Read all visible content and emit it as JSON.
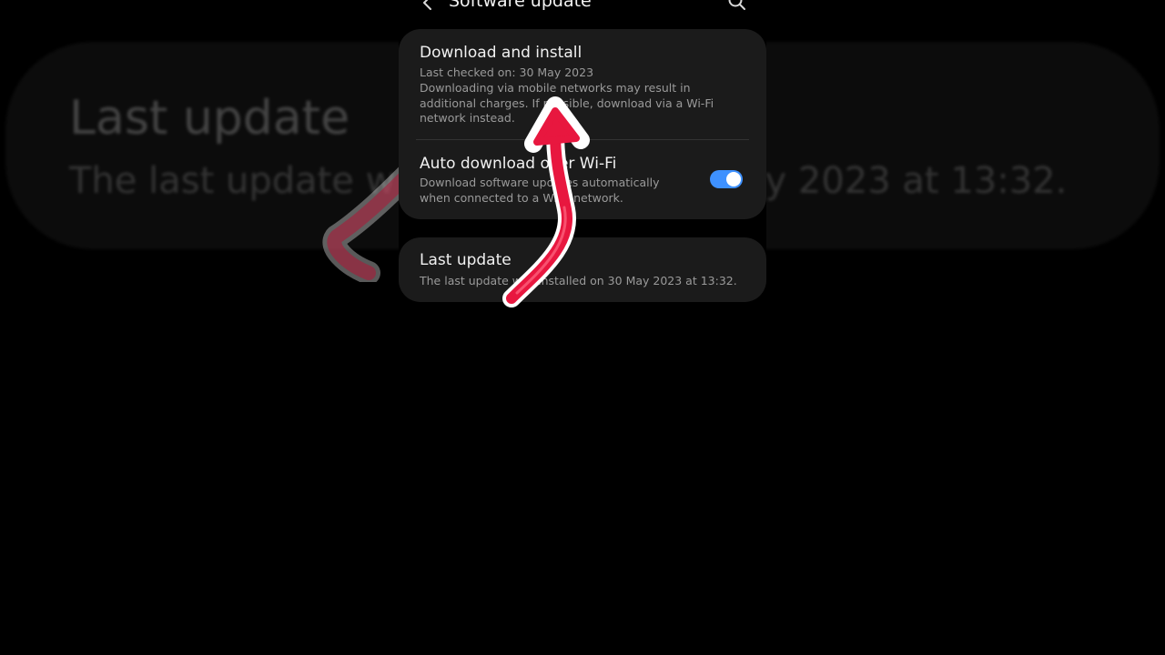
{
  "background": {
    "title": "Last update",
    "subtitle_left": "The last update w",
    "subtitle_right": "ay 2023 at 13:32."
  },
  "header": {
    "title": "Software update",
    "back_icon": "back-chevron-icon",
    "search_icon": "search-icon"
  },
  "download_install": {
    "title": "Download and install",
    "last_checked": "Last checked on: 30 May 2023",
    "note": "Downloading via mobile networks may result in additional charges. If possible, download via a Wi-Fi network instead."
  },
  "auto_download": {
    "title": "Auto download over Wi-Fi",
    "description": "Download software updates automatically when connected to a Wi-Fi network.",
    "enabled": true
  },
  "last_update": {
    "title": "Last update",
    "description": "The last update was installed on 30 May 2023 at 13:32."
  },
  "colors": {
    "toggle_on": "#3e91ff",
    "arrow": "#e8173f",
    "card": "#1b1b1b"
  }
}
